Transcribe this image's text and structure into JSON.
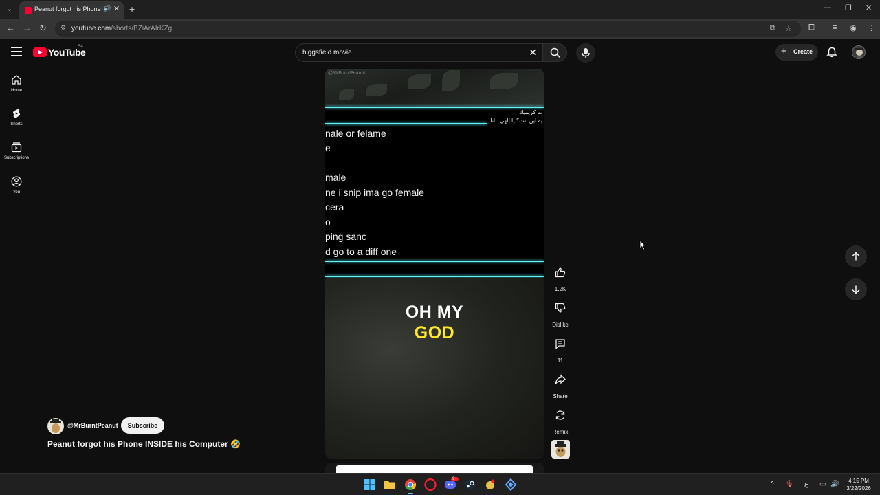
{
  "browser": {
    "tab_title": "Peanut forgot his Phone INSIDE his Computer",
    "url_host": "youtube.com",
    "url_path": "/shorts/BZiArAIrKZg"
  },
  "youtube": {
    "logo_text": "YouTube",
    "country_code": "SA",
    "search_query": "higgsfield movie",
    "create_label": "Create",
    "guide": [
      {
        "label": "Home",
        "icon": "home-icon"
      },
      {
        "label": "Shorts",
        "icon": "shorts-icon"
      },
      {
        "label": "Subscriptions",
        "icon": "subscriptions-icon"
      },
      {
        "label": "You",
        "icon": "you-icon"
      }
    ]
  },
  "short": {
    "watermark": "@MrBurntPeanut",
    "arabic_line1": "ت كريميك",
    "arabic_line2": "يه اين انت؟ يا إلهي.. انا",
    "lyrics": [
      "nale or felame",
      "e",
      "",
      "male",
      "ne i snip ima go female",
      " cera",
      "o",
      "ping sanc",
      "d go to a diff one"
    ],
    "caption_line1": "OH MY",
    "caption_line2": "GOD"
  },
  "actions": {
    "like_count": "1.2K",
    "dislike_label": "Dislike",
    "comment_count": "11",
    "share_label": "Share",
    "remix_label": "Remix"
  },
  "channel": {
    "handle": "@MrBurntPeanut",
    "subscribe_label": "Subscribe",
    "video_title": "Peanut forgot his Phone INSIDE his Computer 🤣"
  },
  "taskbar": {
    "time": "4:15 PM",
    "date": "3/22/2026",
    "ime": "ع",
    "badge": "9+"
  },
  "colors": {
    "brand_red": "#ff0033",
    "neon_cyan": "#5ef0f5",
    "caption_yellow": "#ffe629"
  }
}
